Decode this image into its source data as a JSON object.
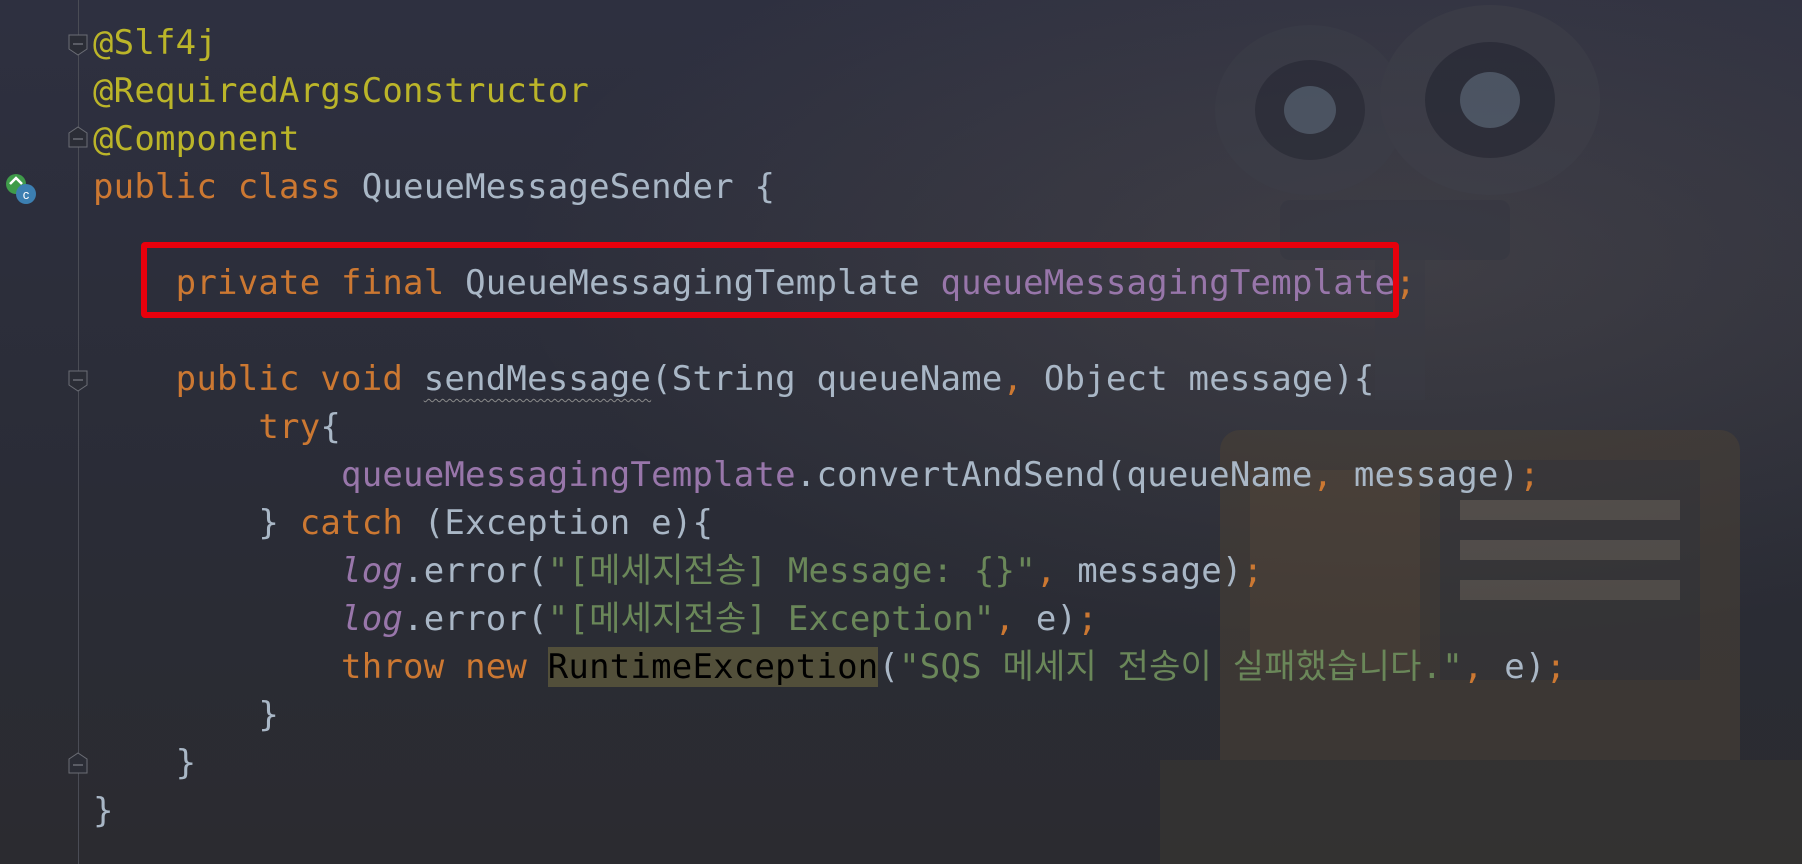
{
  "editor": {
    "lines": [
      {
        "tokens": [
          {
            "t": "@Slf4j",
            "c": "ann"
          }
        ]
      },
      {
        "tokens": [
          {
            "t": "@RequiredArgsConstructor",
            "c": "ann"
          }
        ]
      },
      {
        "tokens": [
          {
            "t": "@Component",
            "c": "ann"
          }
        ]
      },
      {
        "tokens": [
          {
            "t": "public ",
            "c": "kw"
          },
          {
            "t": "class ",
            "c": "kw"
          },
          {
            "t": "QueueMessageSender {",
            "c": "plain"
          }
        ]
      },
      {
        "tokens": []
      },
      {
        "tokens": [
          {
            "t": "    private ",
            "c": "kw"
          },
          {
            "t": "final ",
            "c": "kw"
          },
          {
            "t": "QueueMessagingTemplate ",
            "c": "plain"
          },
          {
            "t": "queueMessagingTemplate",
            "c": "field"
          },
          {
            "t": ";",
            "c": "punct"
          }
        ]
      },
      {
        "tokens": []
      },
      {
        "tokens": [
          {
            "t": "    public ",
            "c": "kw"
          },
          {
            "t": "void ",
            "c": "kw"
          },
          {
            "t": "sendMessage",
            "c": "method"
          },
          {
            "t": "(String queueName",
            "c": "plain"
          },
          {
            "t": ", ",
            "c": "punct"
          },
          {
            "t": "Object message){",
            "c": "plain"
          }
        ]
      },
      {
        "tokens": [
          {
            "t": "        try",
            "c": "kw"
          },
          {
            "t": "{",
            "c": "plain"
          }
        ]
      },
      {
        "tokens": [
          {
            "t": "            queueMessagingTemplate",
            "c": "field"
          },
          {
            "t": ".convertAndSend(queueName",
            "c": "plain"
          },
          {
            "t": ", ",
            "c": "punct"
          },
          {
            "t": "message)",
            "c": "plain"
          },
          {
            "t": ";",
            "c": "punct"
          }
        ]
      },
      {
        "tokens": [
          {
            "t": "        } ",
            "c": "plain"
          },
          {
            "t": "catch ",
            "c": "kw"
          },
          {
            "t": "(Exception e){",
            "c": "plain"
          }
        ]
      },
      {
        "tokens": [
          {
            "t": "            ",
            "c": "plain"
          },
          {
            "t": "log",
            "c": "field-it"
          },
          {
            "t": ".error(",
            "c": "plain"
          },
          {
            "t": "\"[메세지전송] Message: {}\"",
            "c": "str"
          },
          {
            "t": ", ",
            "c": "punct"
          },
          {
            "t": "message)",
            "c": "plain"
          },
          {
            "t": ";",
            "c": "punct"
          }
        ]
      },
      {
        "tokens": [
          {
            "t": "            ",
            "c": "plain"
          },
          {
            "t": "log",
            "c": "field-it"
          },
          {
            "t": ".error(",
            "c": "plain"
          },
          {
            "t": "\"[메세지전송] Exception\"",
            "c": "str"
          },
          {
            "t": ", ",
            "c": "punct"
          },
          {
            "t": "e)",
            "c": "plain"
          },
          {
            "t": ";",
            "c": "punct"
          }
        ]
      },
      {
        "tokens": [
          {
            "t": "            throw ",
            "c": "kw"
          },
          {
            "t": "new ",
            "c": "kw"
          },
          {
            "t": "RuntimeException",
            "c": "hl"
          },
          {
            "t": "(",
            "c": "plain"
          },
          {
            "t": "\"SQS 메세지 전송이 실패했습니다.\"",
            "c": "str"
          },
          {
            "t": ", ",
            "c": "punct"
          },
          {
            "t": "e)",
            "c": "plain"
          },
          {
            "t": ";",
            "c": "punct"
          }
        ]
      },
      {
        "tokens": [
          {
            "t": "        }",
            "c": "plain"
          }
        ]
      },
      {
        "tokens": [
          {
            "t": "    }",
            "c": "plain"
          }
        ]
      },
      {
        "tokens": [
          {
            "t": "}",
            "c": "plain"
          }
        ]
      }
    ]
  },
  "colors": {
    "annotation": "#bbb529",
    "keyword": "#cc7832",
    "text": "#a9b7c6",
    "field": "#9876aa",
    "string": "#6a8759",
    "highlight_border": "#e8000c"
  },
  "icons": {
    "class_gutter": "class-implementation-icon",
    "fold": "fold-marker-icon",
    "background": "robot-wallpaper-icon"
  }
}
